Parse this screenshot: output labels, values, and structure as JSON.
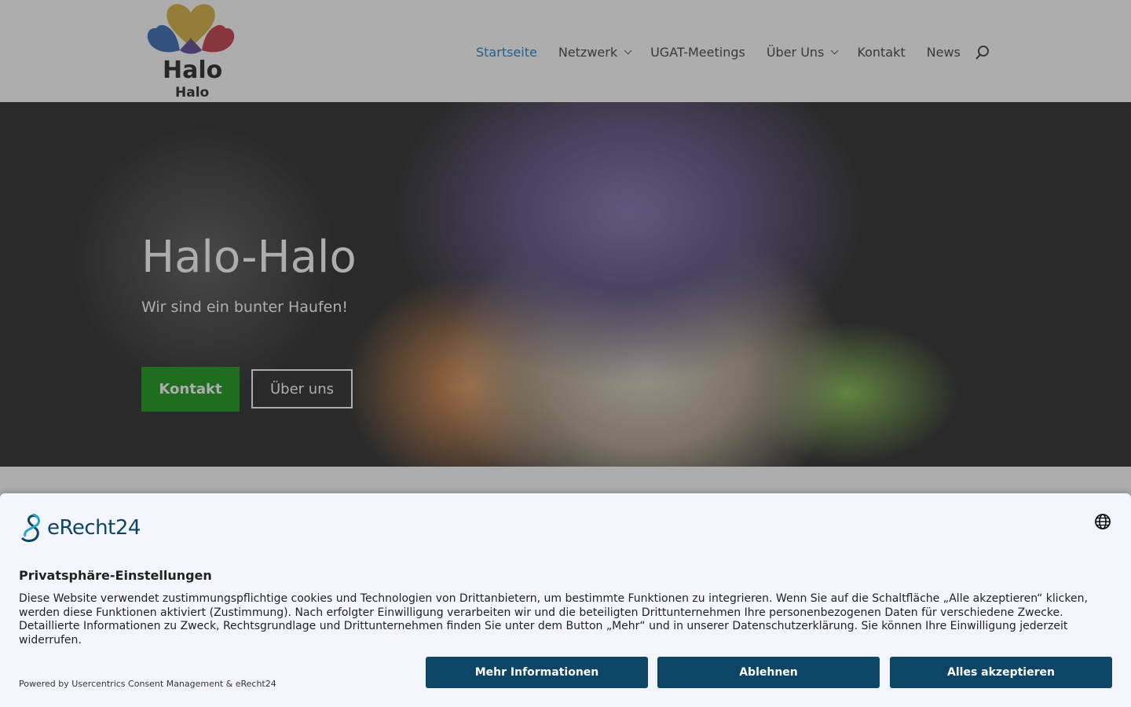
{
  "logo": {
    "line1": "Halo",
    "line2": "Halo"
  },
  "nav": {
    "items": [
      {
        "label": "Startseite",
        "active": true,
        "has_dropdown": false
      },
      {
        "label": "Netzwerk",
        "active": false,
        "has_dropdown": true
      },
      {
        "label": "UGAT-Meetings",
        "active": false,
        "has_dropdown": false
      },
      {
        "label": "Über Uns",
        "active": false,
        "has_dropdown": true
      },
      {
        "label": "Kontakt",
        "active": false,
        "has_dropdown": false
      },
      {
        "label": "News",
        "active": false,
        "has_dropdown": false
      }
    ],
    "search_icon": "search-icon"
  },
  "hero": {
    "title": "Halo-Halo",
    "subtitle": "Wir sind ein bunter Haufen!",
    "primary_button": "Kontakt",
    "secondary_button": "Über uns"
  },
  "consent": {
    "brand": "eRecht24",
    "title": "Privatsphäre-Einstellungen",
    "text": "Diese Website verwendet zustimmungspflichtige cookies und Technologien von Drittanbietern, um bestimmte Funktionen zu integrieren. Wenn Sie auf die Schaltfläche „Alle akzeptieren“ klicken, werden diese Funktionen aktiviert (Zustimmung). Nach erfolgter Einwilligung verarbeiten wir und die beteiligten Drittunternehmen Ihre personenbezogenen Daten für verschiedene Zwecke. Detaillierte Informationen zu Zweck, Rechtsgrundlage und Drittunternehmen finden Sie unter dem Button „Mehr“ und in unserer Datenschutzerklärung. Sie können Ihre Einwilligung jederzeit widerrufen.",
    "powered_by": "Powered by Usercentrics Consent Management & eRecht24",
    "buttons": {
      "more": "Mehr Informationen",
      "deny": "Ablehnen",
      "accept": "Alles akzeptieren"
    }
  },
  "colors": {
    "nav_active": "#2e8fd6",
    "primary_green": "#2ea32e",
    "consent_button": "#0d4566",
    "consent_bg": "#f3f7fd"
  }
}
